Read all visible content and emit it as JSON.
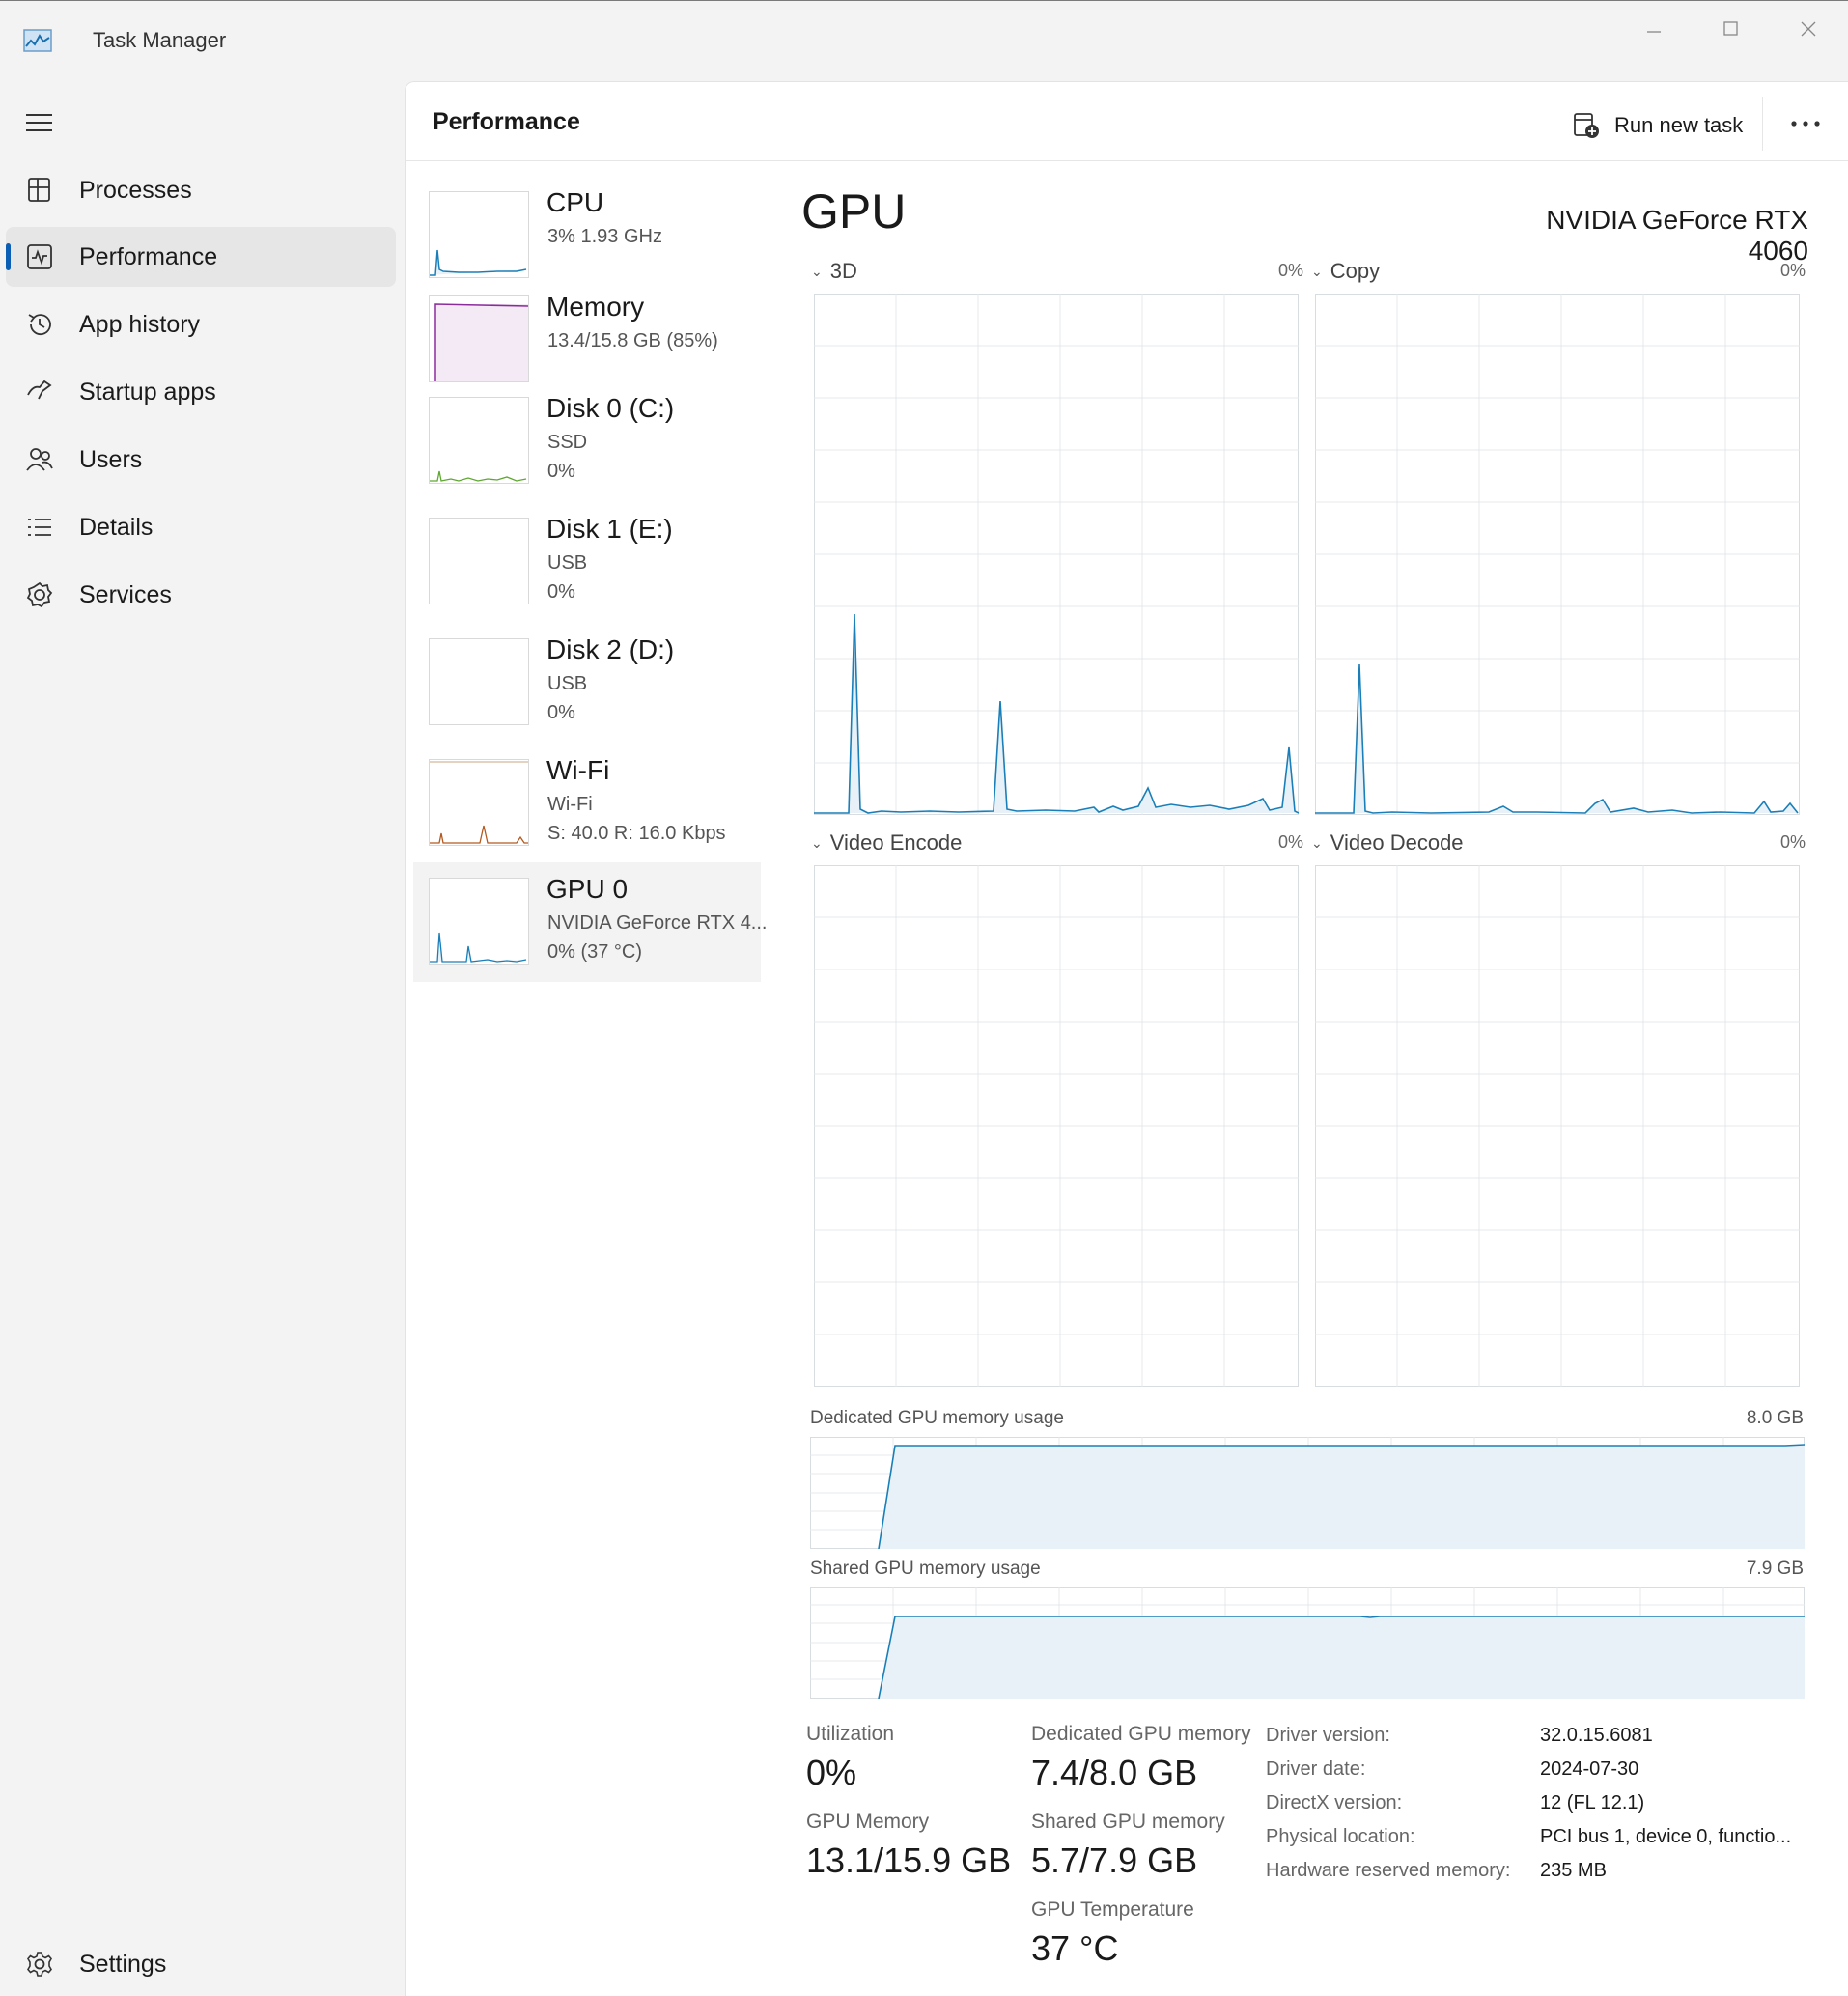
{
  "window": {
    "title": "Task Manager"
  },
  "nav": {
    "items": [
      {
        "label": "Processes",
        "icon": "processes-icon"
      },
      {
        "label": "Performance",
        "icon": "performance-icon",
        "selected": true
      },
      {
        "label": "App history",
        "icon": "history-icon"
      },
      {
        "label": "Startup apps",
        "icon": "startup-icon"
      },
      {
        "label": "Users",
        "icon": "users-icon"
      },
      {
        "label": "Details",
        "icon": "details-icon"
      },
      {
        "label": "Services",
        "icon": "services-icon"
      }
    ],
    "settings_label": "Settings"
  },
  "header": {
    "title": "Performance",
    "run_task_label": "Run new task",
    "more_label": "..."
  },
  "resources": [
    {
      "name": "CPU",
      "line1": "3%  1.93 GHz",
      "line2": "",
      "color": "#1a7fb8"
    },
    {
      "name": "Memory",
      "line1": "13.4/15.8 GB (85%)",
      "line2": "",
      "color": "#8b2c9c"
    },
    {
      "name": "Disk 0 (C:)",
      "line1": "SSD",
      "line2": "0%",
      "color": "#5ea82f"
    },
    {
      "name": "Disk 1 (E:)",
      "line1": "USB",
      "line2": "0%",
      "color": "#5ea82f"
    },
    {
      "name": "Disk 2 (D:)",
      "line1": "USB",
      "line2": "0%",
      "color": "#5ea82f"
    },
    {
      "name": "Wi-Fi",
      "line1": "Wi-Fi",
      "line2": "S: 40.0  R: 16.0 Kbps",
      "color": "#b3591f"
    },
    {
      "name": "GPU 0",
      "line1": "NVIDIA GeForce RTX 4...",
      "line2": "0%  (37 °C)",
      "color": "#1a7fb8",
      "selected": true
    }
  ],
  "gpu": {
    "title": "GPU",
    "model": "NVIDIA GeForce RTX 4060",
    "engines": [
      {
        "label": "3D",
        "pct": "0%"
      },
      {
        "label": "Copy",
        "pct": "0%"
      },
      {
        "label": "Video Encode",
        "pct": "0%"
      },
      {
        "label": "Video Decode",
        "pct": "0%"
      }
    ],
    "dedicated_label": "Dedicated GPU memory usage",
    "dedicated_max": "8.0 GB",
    "shared_label": "Shared GPU memory usage",
    "shared_max": "7.9 GB",
    "stats": {
      "utilization_label": "Utilization",
      "utilization_value": "0%",
      "gpu_memory_label": "GPU Memory",
      "gpu_memory_value": "13.1/15.9 GB",
      "dedicated_label": "Dedicated GPU memory",
      "dedicated_value": "7.4/8.0 GB",
      "shared_label": "Shared GPU memory",
      "shared_value": "5.7/7.9 GB",
      "temp_label": "GPU Temperature",
      "temp_value": "37 °C"
    },
    "info": [
      {
        "label": "Driver version:",
        "value": "32.0.15.6081"
      },
      {
        "label": "Driver date:",
        "value": "2024-07-30"
      },
      {
        "label": "DirectX version:",
        "value": "12 (FL 12.1)"
      },
      {
        "label": "Physical location:",
        "value": "PCI bus 1, device 0, functio..."
      },
      {
        "label": "Hardware reserved memory:",
        "value": "235 MB"
      }
    ]
  },
  "colors": {
    "accent": "#0a5fb4",
    "gpu_line": "#1a7fb8",
    "gpu_fill": "#e8f1f8",
    "grid": "#e4e8ec"
  }
}
